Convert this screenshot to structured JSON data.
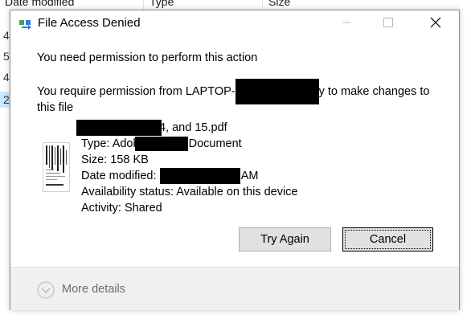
{
  "background": {
    "columns": [
      {
        "label": "Date modified"
      },
      {
        "label": "Type"
      },
      {
        "label": "Size"
      }
    ],
    "row_digits": [
      "4",
      "5",
      "4",
      "2"
    ]
  },
  "dialog": {
    "title": "File Access Denied",
    "icons": {
      "title": "file-transfer-icon",
      "minimize": "minimize-icon",
      "maximize": "maximize-icon",
      "close": "close-icon"
    },
    "heading": "You need permission to perform this action",
    "message_prefix": "You require permission from LAPTOP-",
    "message_suffix": "y to make changes to this file",
    "file": {
      "name_suffix": "4, and 15.pdf",
      "type_prefix": "Type: Adob",
      "type_suffix": "Document",
      "size": "Size: 158 KB",
      "date_label": "Date modified:",
      "date_suffix": "AM",
      "availability": "Availability status: Available on this device",
      "activity": "Activity: Shared",
      "thumbnail_icon": "pdf-document-thumbnail-icon"
    },
    "buttons": {
      "retry": "Try Again",
      "cancel": "Cancel"
    },
    "footer": {
      "more_details": "More details",
      "more_icon": "chevron-down-circle-icon"
    }
  },
  "colors": {
    "button_face": "#e1e1e1",
    "button_border": "#adadad",
    "footer_bg": "#f0f0f0",
    "redaction": "#000000",
    "muted_text": "#6d6d6d"
  }
}
